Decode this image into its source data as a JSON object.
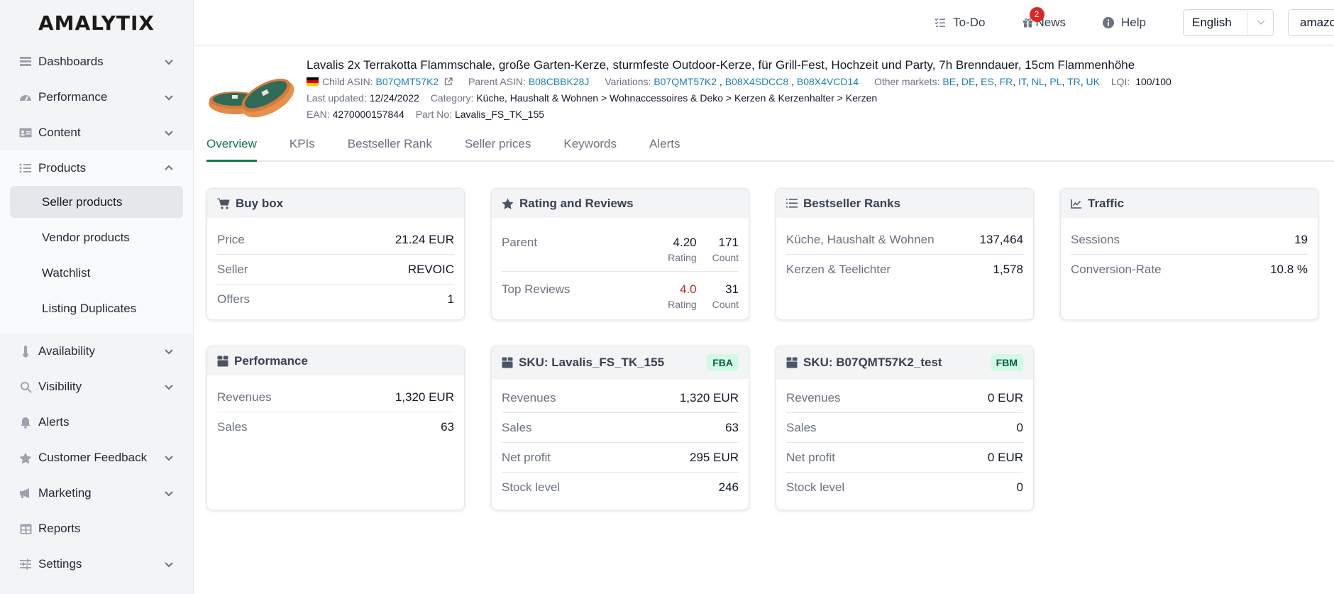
{
  "app": {
    "logo": "AMALYTIX"
  },
  "sidebar": {
    "items": [
      {
        "label": "Dashboards",
        "icon": "dashboard-icon",
        "expandable": true
      },
      {
        "label": "Performance",
        "icon": "gauge-icon",
        "expandable": true
      },
      {
        "label": "Content",
        "icon": "id-card-icon",
        "expandable": true
      },
      {
        "label": "Products",
        "icon": "list-icon",
        "expanded": true,
        "children": [
          {
            "label": "Seller products",
            "active": true
          },
          {
            "label": "Vendor products"
          },
          {
            "label": "Watchlist"
          },
          {
            "label": "Listing Duplicates"
          }
        ]
      },
      {
        "label": "Availability",
        "icon": "thermometer-icon",
        "expandable": true
      },
      {
        "label": "Visibility",
        "icon": "search-icon",
        "expandable": true
      },
      {
        "label": "Alerts",
        "icon": "bell-icon",
        "expandable": false
      },
      {
        "label": "Customer Feedback",
        "icon": "star-icon",
        "expandable": true
      },
      {
        "label": "Marketing",
        "icon": "megaphone-icon",
        "expandable": true
      },
      {
        "label": "Reports",
        "icon": "table-icon",
        "expandable": false
      },
      {
        "label": "Settings",
        "icon": "sliders-icon",
        "expandable": true
      }
    ]
  },
  "topbar": {
    "todo": "To-Do",
    "news": "News",
    "news_badge": "2",
    "help": "Help",
    "language": "English",
    "account": "amazon@revoic.com"
  },
  "product": {
    "title": "Lavalis 2x Terrakotta Flammschale, große Garten-Kerze, sturmfeste Outdoor-Kerze, für Grill-Fest, Hochzeit und Party, 7h Brenndauer, 15cm Flammenhöhe",
    "child_asin_label": "Child ASIN:",
    "child_asin": "B07QMT57K2",
    "parent_asin_label": "Parent ASIN:",
    "parent_asin": "B08CBBK28J",
    "variations_label": "Variations:",
    "variations": [
      "B07QMT57K2",
      "B08X4SDCC8",
      "B08X4VCD14"
    ],
    "other_markets_label": "Other markets:",
    "other_markets": [
      "BE",
      "DE",
      "ES",
      "FR",
      "IT",
      "NL",
      "PL",
      "TR",
      "UK"
    ],
    "lqi_label": "LQI:",
    "lqi": "100/100",
    "last_updated_label": "Last updated:",
    "last_updated": "12/24/2022",
    "category_label": "Category:",
    "category": "Küche, Haushalt & Wohnen > Wohnaccessoires & Deko > Kerzen & Kerzenhalter > Kerzen",
    "ean_label": "EAN:",
    "ean": "4270000157844",
    "part_no_label": "Part No:",
    "part_no": "Lavalis_FS_TK_155"
  },
  "tabs": [
    {
      "label": "Overview",
      "active": true
    },
    {
      "label": "KPIs"
    },
    {
      "label": "Bestseller Rank"
    },
    {
      "label": "Seller prices"
    },
    {
      "label": "Keywords"
    },
    {
      "label": "Alerts"
    }
  ],
  "cards": {
    "buybox": {
      "title": "Buy box",
      "rows": [
        {
          "k": "Price",
          "v": "21.24 EUR"
        },
        {
          "k": "Seller",
          "v": "REVOIC"
        },
        {
          "k": "Offers",
          "v": "1"
        }
      ]
    },
    "reviews": {
      "title": "Rating and Reviews",
      "rows": [
        {
          "k": "Parent",
          "rating": "4.20",
          "rating_label": "Rating",
          "count": "171",
          "count_label": "Count"
        },
        {
          "k": "Top Reviews",
          "rating": "4.0",
          "rating_label": "Rating",
          "count": "31",
          "count_label": "Count",
          "rating_color": "#c62828"
        }
      ]
    },
    "bsr": {
      "title": "Bestseller Ranks",
      "rows": [
        {
          "k": "Küche, Haushalt & Wohnen",
          "v": "137,464"
        },
        {
          "k": "Kerzen & Teelichter",
          "v": "1,578"
        }
      ]
    },
    "traffic": {
      "title": "Traffic",
      "rows": [
        {
          "k": "Sessions",
          "v": "19"
        },
        {
          "k": "Conversion-Rate",
          "v": "10.8 %"
        }
      ]
    },
    "performance": {
      "title": "Performance",
      "rows": [
        {
          "k": "Revenues",
          "v": "1,320 EUR"
        },
        {
          "k": "Sales",
          "v": "63"
        }
      ]
    },
    "sku1": {
      "title": "SKU: Lavalis_FS_TK_155",
      "tag": "FBA",
      "rows": [
        {
          "k": "Revenues",
          "v": "1,320 EUR"
        },
        {
          "k": "Sales",
          "v": "63"
        },
        {
          "k": "Net profit",
          "v": "295 EUR"
        },
        {
          "k": "Stock level",
          "v": "246"
        }
      ]
    },
    "sku2": {
      "title": "SKU: B07QMT57K2_test",
      "tag": "FBM",
      "rows": [
        {
          "k": "Revenues",
          "v": "0 EUR"
        },
        {
          "k": "Sales",
          "v": "0"
        },
        {
          "k": "Net profit",
          "v": "0 EUR"
        },
        {
          "k": "Stock level",
          "v": "0"
        }
      ]
    }
  }
}
